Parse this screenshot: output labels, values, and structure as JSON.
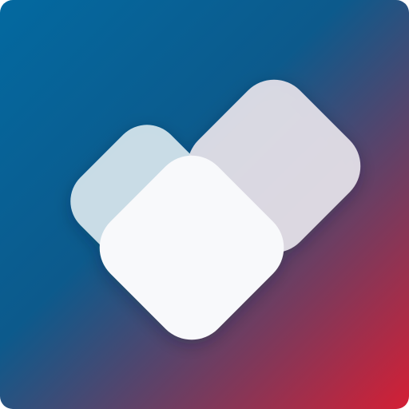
{
  "app_icon": {
    "icon": "heart-icon",
    "colors": {
      "gradient_start": "#0369a0",
      "gradient_mid": "#0c5a8c",
      "gradient_end": "#d41f35",
      "tile_left": "#d3e3ec",
      "tile_right": "#e5e2ea",
      "tile_front": "#f8f9fb"
    }
  }
}
